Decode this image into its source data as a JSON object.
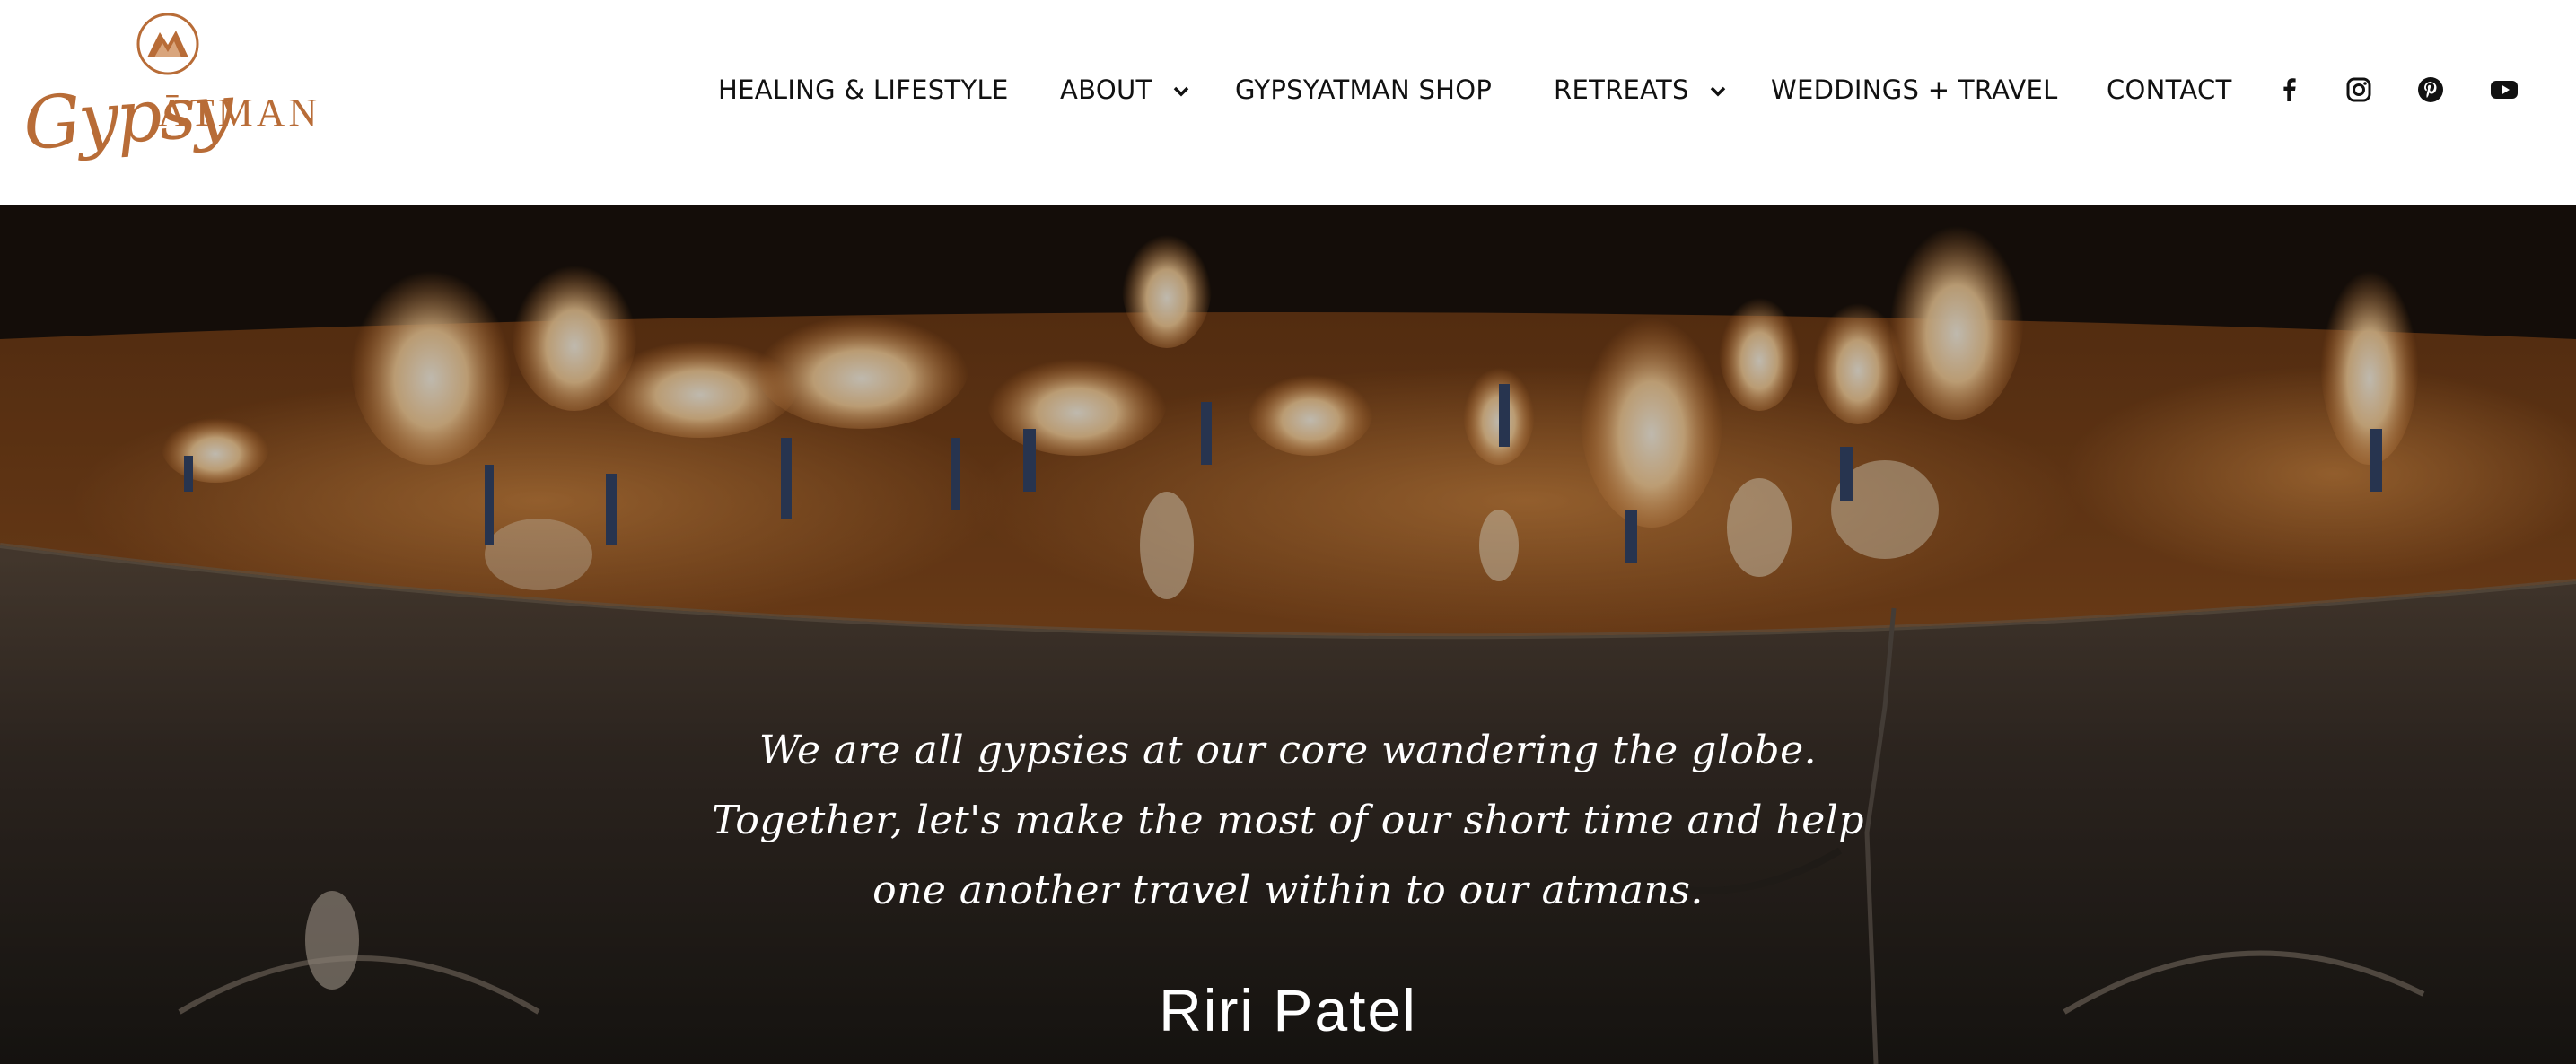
{
  "brand": {
    "logo_primary": "Gypsy",
    "logo_secondary": "ĀTMAN",
    "accent_color": "#b86c37"
  },
  "nav": {
    "items": [
      {
        "label": "HEALING & LIFESTYLE",
        "has_dropdown": false
      },
      {
        "label": "ABOUT",
        "has_dropdown": true
      },
      {
        "label": "GYPSYATMAN SHOP",
        "has_dropdown": false
      },
      {
        "label": "RETREATS",
        "has_dropdown": true
      },
      {
        "label": "WEDDINGS + TRAVEL",
        "has_dropdown": false
      },
      {
        "label": "CONTACT",
        "has_dropdown": false
      }
    ],
    "social_icons": [
      "facebook-icon",
      "instagram-icon",
      "pinterest-icon",
      "youtube-icon"
    ]
  },
  "hero": {
    "background": "candles burning in a large metal bowl",
    "quote": "We are all gypsies at our core wandering the globe. Together, let's make the most of our short time and help one another travel within to our atmans.",
    "author": "Riri Patel"
  }
}
